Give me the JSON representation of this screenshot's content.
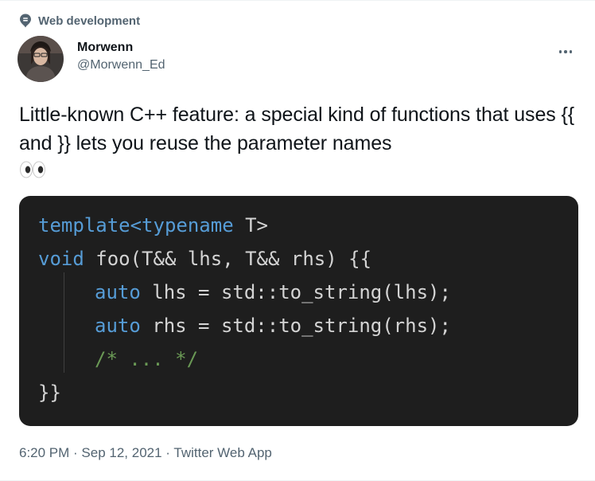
{
  "social_context": {
    "label": "Web development",
    "icon": "topic-pin-icon"
  },
  "author": {
    "display_name": "Morwenn",
    "handle": "@Morwenn_Ed",
    "avatar_icon": "avatar"
  },
  "tweet": {
    "text": "Little-known C++ feature: a special kind of functions that uses {{ and }} lets you reuse the parameter names",
    "emoji_icon": "eyes-emoji-icon"
  },
  "code_image": {
    "lines": [
      [
        {
          "t": "template<typename ",
          "c": "kw"
        },
        {
          "t": "T>",
          "c": "tx"
        }
      ],
      [
        {
          "t": "void ",
          "c": "kw"
        },
        {
          "t": "foo(T&& lhs, T&& rhs) {{",
          "c": "tx"
        }
      ],
      [
        {
          "t": "auto ",
          "c": "kw"
        },
        {
          "t": "lhs = std::to_string(lhs);",
          "c": "tx"
        }
      ],
      [
        {
          "t": "auto ",
          "c": "kw"
        },
        {
          "t": "rhs = std::to_string(rhs);",
          "c": "tx"
        }
      ],
      [
        {
          "t": "/* ... */",
          "c": "cm"
        }
      ],
      [
        {
          "t": "}}",
          "c": "tx"
        }
      ]
    ],
    "colors": {
      "background": "#1e1e1e",
      "keyword": "#569cd6",
      "text": "#d4d4d4",
      "comment": "#6a9955"
    }
  },
  "meta": {
    "time": "6:20 PM",
    "date": "Sep 12, 2021",
    "source": "Twitter Web App",
    "separator": " · "
  },
  "more_menu_icon": "more-horizontal-icon"
}
